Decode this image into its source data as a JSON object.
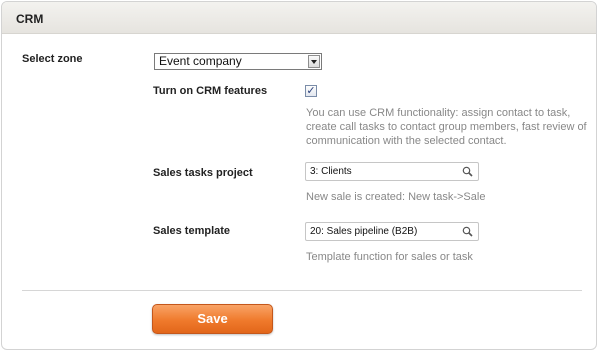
{
  "panel": {
    "title": "CRM"
  },
  "zone": {
    "label": "Select zone",
    "value": "Event company"
  },
  "crm_features": {
    "label": "Turn on CRM features",
    "checked": true,
    "checkmark": "✓",
    "hint_lines": [
      "You can use CRM functionality: assign contact to task,",
      "create call tasks to contact group members, fast review of",
      "communication with the selected contact."
    ]
  },
  "sales_tasks_project": {
    "label": "Sales tasks project",
    "value": "3: Clients",
    "hint": "New sale is created: New task->Sale",
    "icon": "magnifier-icon"
  },
  "sales_template": {
    "label": "Sales template",
    "value": "20: Sales pipeline (B2B)",
    "hint": "Template function for sales or task",
    "icon": "magnifier-icon"
  },
  "actions": {
    "save_label": "Save"
  },
  "colors": {
    "accent": "#ef7a2c",
    "hint_text": "#888888"
  }
}
